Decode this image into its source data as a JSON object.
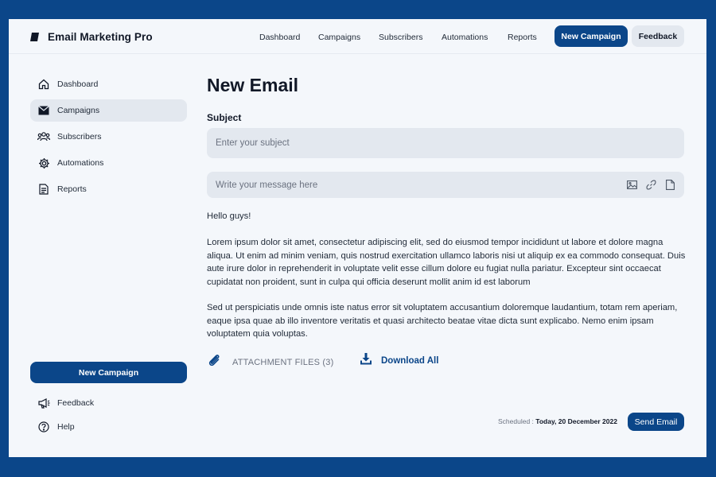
{
  "app": {
    "name": "Email Marketing Pro"
  },
  "topnav": {
    "items": [
      "Dashboard",
      "Campaigns",
      "Subscribers",
      "Automations",
      "Reports"
    ],
    "primary_button": "New Campaign",
    "secondary_button": "Feedback"
  },
  "sidebar": {
    "items": [
      {
        "label": "Dashboard",
        "icon": "home-icon"
      },
      {
        "label": "Campaigns",
        "icon": "envelope-icon",
        "active": true
      },
      {
        "label": "Subscribers",
        "icon": "users-icon"
      },
      {
        "label": "Automations",
        "icon": "gear-icon"
      },
      {
        "label": "Reports",
        "icon": "document-icon"
      }
    ],
    "button": "New Campaign",
    "footer_items": [
      {
        "label": "Feedback",
        "icon": "megaphone-icon"
      },
      {
        "label": "Help",
        "icon": "help-icon"
      }
    ]
  },
  "main": {
    "title": "New Email",
    "subject_label": "Subject",
    "subject_placeholder": "Enter  your subject",
    "message_placeholder": "Write  your message here",
    "greeting": "Hello guys!",
    "paragraph1": "Lorem ipsum dolor sit amet, consectetur adipiscing elit, sed do eiusmod tempor incididunt ut labore et dolore magna aliqua. Ut enim ad minim veniam, quis nostrud exercitation ullamco laboris nisi ut aliquip ex ea commodo consequat. Duis aute irure dolor in reprehenderit in voluptate velit esse cillum dolore eu fugiat nulla pariatur. Excepteur sint occaecat cupidatat non proident, sunt in culpa qui officia deserunt mollit anim id est laborum",
    "paragraph2": "Sed ut perspiciatis unde omnis iste natus error sit voluptatem accusantium doloremque laudantium, totam rem aperiam, eaque ipsa quae ab illo inventore veritatis et quasi architecto beatae vitae dicta sunt explicabo. Nemo enim ipsam voluptatem quia voluptas.",
    "attachment_label": "ATTACHMENT FILES (3)",
    "download_label": "Download All",
    "scheduled_label": "Scheduled :",
    "scheduled_value": "Today, 20 December 2022",
    "send_button": "Send Email"
  },
  "colors": {
    "brand": "#0b4689",
    "panel": "#f4f7fb",
    "field": "#e3e8ef"
  }
}
